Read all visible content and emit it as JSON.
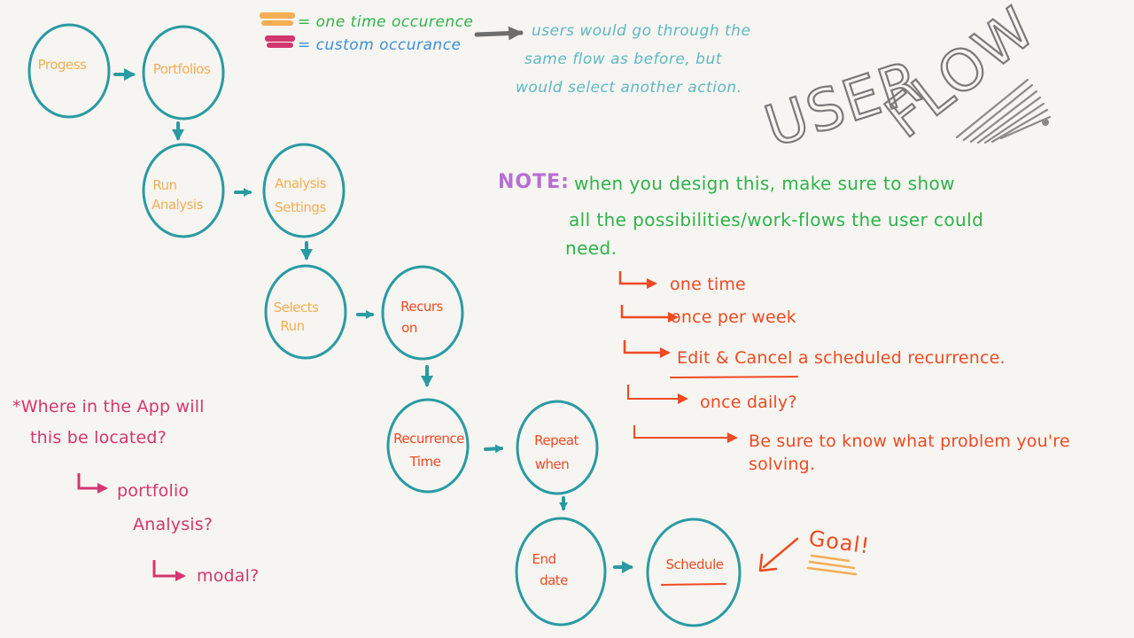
{
  "title": {
    "word1": "USER",
    "word2": "FLOW"
  },
  "legend": {
    "one_time": "= one time occurence",
    "custom": "= custom occurance",
    "note": [
      "users would go through the",
      "same flow as before, but",
      "would select another action."
    ]
  },
  "nodes": {
    "progress": [
      "Progess"
    ],
    "portfolios": [
      "Portfolios"
    ],
    "run_analysis": [
      "Run",
      "Analysis"
    ],
    "analysis_settings": [
      "Analysis",
      "Settings"
    ],
    "selects_run": [
      "Selects",
      "Run"
    ],
    "recurs_on": [
      "Recurs",
      "on"
    ],
    "recurrence_time": [
      "Recurrence",
      "Time"
    ],
    "repeat_when": [
      "Repeat",
      "when"
    ],
    "end_date": [
      "End",
      "date"
    ],
    "schedule": [
      "Schedule"
    ]
  },
  "note": {
    "label": "NOTE:",
    "lines": [
      "when you design this, make sure to show",
      "all the possibilities/work-flows the user could",
      "need."
    ],
    "options": [
      "one time",
      "once per week",
      "Edit & Cancel a scheduled recurrence.",
      "once daily?",
      "Be sure to know what problem you're",
      "solving."
    ]
  },
  "location": {
    "question": [
      "*Where in the App will",
      "this be located?"
    ],
    "answers": [
      "portfolio",
      "Analysis?",
      "modal?"
    ]
  },
  "goal": "Goal!",
  "colors": {
    "circle": "#2a9aa3",
    "arrow": "#2a9aa3",
    "orange": "#f4ae55",
    "red": "#ef4a22",
    "green": "#2fb34a",
    "magenta": "#d4366e",
    "teal_text": "#5fb8c4",
    "purple": "#b86fd2",
    "gray": "#8a8a8a"
  }
}
